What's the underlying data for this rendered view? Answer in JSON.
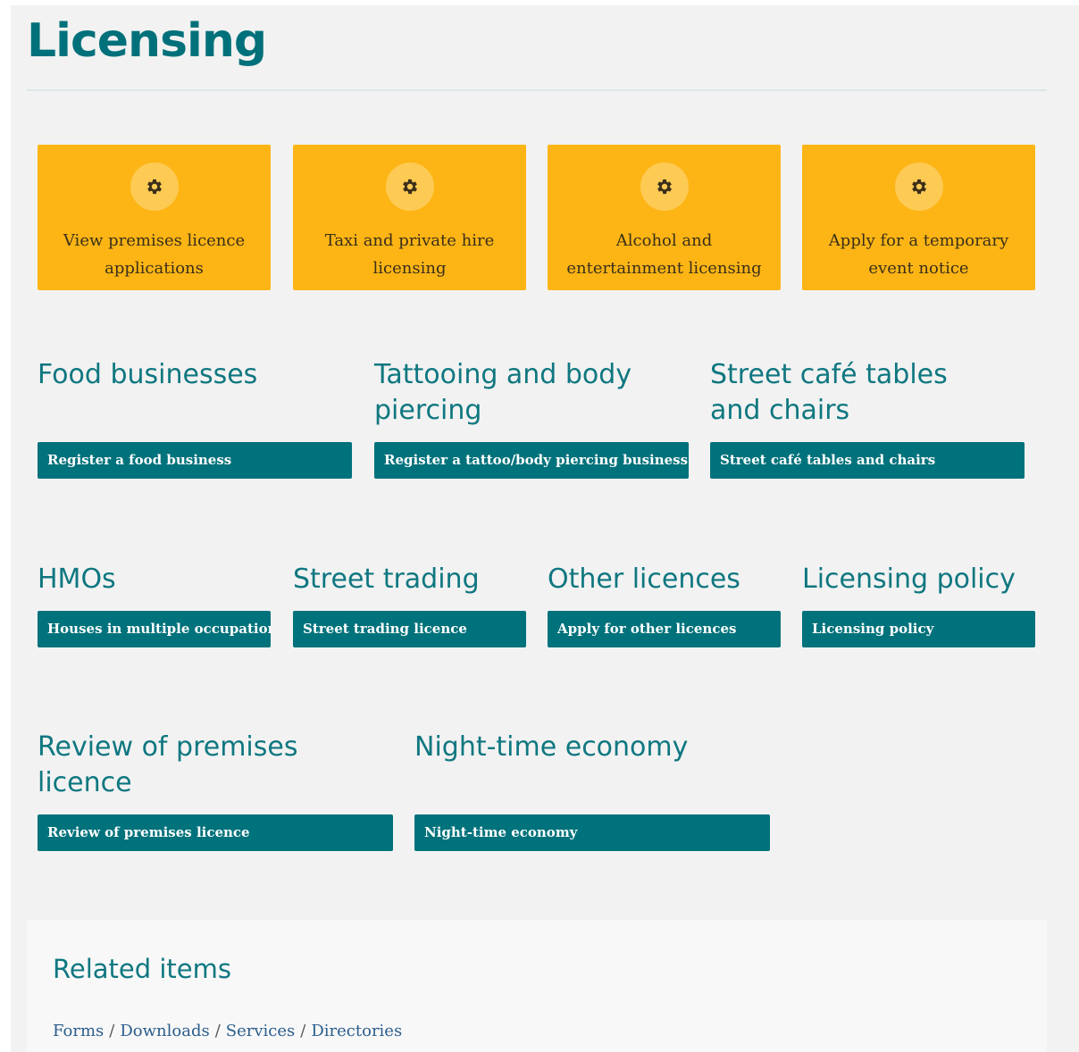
{
  "page": {
    "title": "Licensing"
  },
  "tiles": [
    {
      "label": "View premises licence applications",
      "icon": "gear-icon"
    },
    {
      "label": "Taxi and private hire licensing",
      "icon": "gear-icon"
    },
    {
      "label": "Alcohol and entertainment licensing",
      "icon": "gear-icon"
    },
    {
      "label": "Apply for a temporary event notice",
      "icon": "gear-icon"
    }
  ],
  "sections": {
    "food": {
      "heading": "Food businesses",
      "link": "Register a food business"
    },
    "tattoo": {
      "heading_line1": "Tattooing and body",
      "heading_line2": "piercing",
      "link": "Register a tattoo/body piercing business"
    },
    "cafe": {
      "heading_line1": "Street café tables",
      "heading_line2": "and chairs",
      "link": "Street café tables and chairs"
    },
    "hmo": {
      "heading": "HMOs",
      "link": "Houses in multiple occupation"
    },
    "trading": {
      "heading": "Street trading",
      "link": "Street trading licence"
    },
    "other": {
      "heading": "Other licences",
      "link": "Apply for other licences"
    },
    "policy": {
      "heading": "Licensing policy",
      "link": "Licensing policy"
    },
    "review": {
      "heading_line1": "Review of premises",
      "heading_line2": "licence",
      "link": "Review of premises licence"
    },
    "night": {
      "heading": "Night-time economy",
      "link": "Night-time economy"
    }
  },
  "related": {
    "heading": "Related items",
    "links": [
      "Forms",
      "Downloads",
      "Services",
      "Directories"
    ],
    "separator": "/"
  },
  "colors": {
    "tile_bg": "#fdb515",
    "teal": "#00727b",
    "heading": "#0f7780"
  }
}
